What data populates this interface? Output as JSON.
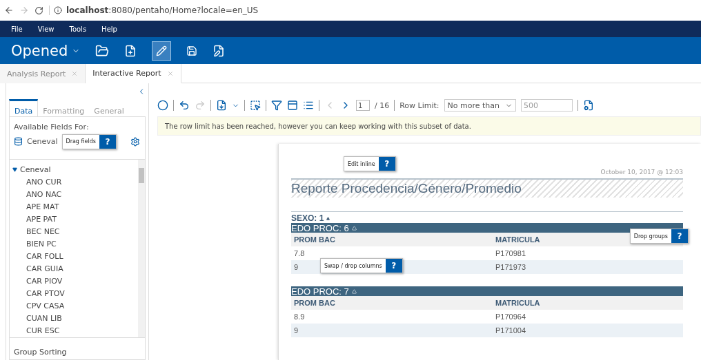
{
  "browser": {
    "url": "**localhost**:8080/pentaho/Home?locale=en_US"
  },
  "menu": [
    "File",
    "View",
    "Tools",
    "Help"
  ],
  "perspective": {
    "label": "Opened",
    "edit_selected": true
  },
  "doc_tabs": [
    {
      "label": "Analysis Report",
      "selected": false
    },
    {
      "label": "Interactive Report",
      "selected": true
    }
  ],
  "left_panel": {
    "tabs": [
      {
        "label": "Data",
        "selected": true
      },
      {
        "label": "Formatting",
        "selected": false
      },
      {
        "label": "General",
        "selected": false
      }
    ],
    "available_label": "Available Fields For:",
    "source": "Ceneval",
    "tooltip": {
      "text": "Drag fields",
      "help": "?"
    },
    "tree": {
      "label": "Ceneval",
      "expanded": true,
      "children": [
        {
          "label": "ANO CUR"
        },
        {
          "label": "ANO NAC"
        },
        {
          "label": "APE MAT"
        },
        {
          "label": "APE PAT"
        },
        {
          "label": "BEC NEC"
        },
        {
          "label": "BIEN PC"
        },
        {
          "label": "CAR FOLL"
        },
        {
          "label": "CAR GUIA"
        },
        {
          "label": "CAR PIOV"
        },
        {
          "label": "CAR PTOV"
        },
        {
          "label": "CPV CASA"
        },
        {
          "label": "CUAN LIB"
        },
        {
          "label": "CUR ESC"
        }
      ]
    },
    "group_sorting": "Group Sorting"
  },
  "report_toolbar": {
    "page": "1",
    "total": "/ 16",
    "row_limit_label": "Row Limit:",
    "row_limit_select": "No more than",
    "row_limit_value": "500"
  },
  "message": "The row limit has been reached, however you can keep working with this subset of data.",
  "report": {
    "date": "October 10, 2017 @ 12:03",
    "title": "Reporte Procedencia/Género/Promedio",
    "edit_tooltip": {
      "text": "Edit inline",
      "help": "?"
    },
    "drop_groups_tooltip": {
      "text": "Drop groups",
      "help": "?"
    },
    "swap_tooltip": {
      "text": "Swap / drop columns",
      "help": "?"
    },
    "group": "SEXO: 1",
    "subgroups": [
      {
        "label": "EDO PROC: 6",
        "columns": [
          "PROM BAC",
          "MATRICULA"
        ],
        "rows": [
          [
            "7.8",
            "P170981"
          ],
          [
            "9",
            "P171973"
          ]
        ]
      },
      {
        "label": "EDO PROC: 7",
        "columns": [
          "PROM BAC",
          "MATRICULA"
        ],
        "rows": [
          [
            "8.9",
            "P170964"
          ],
          [
            "9",
            "P171004"
          ]
        ]
      }
    ]
  }
}
